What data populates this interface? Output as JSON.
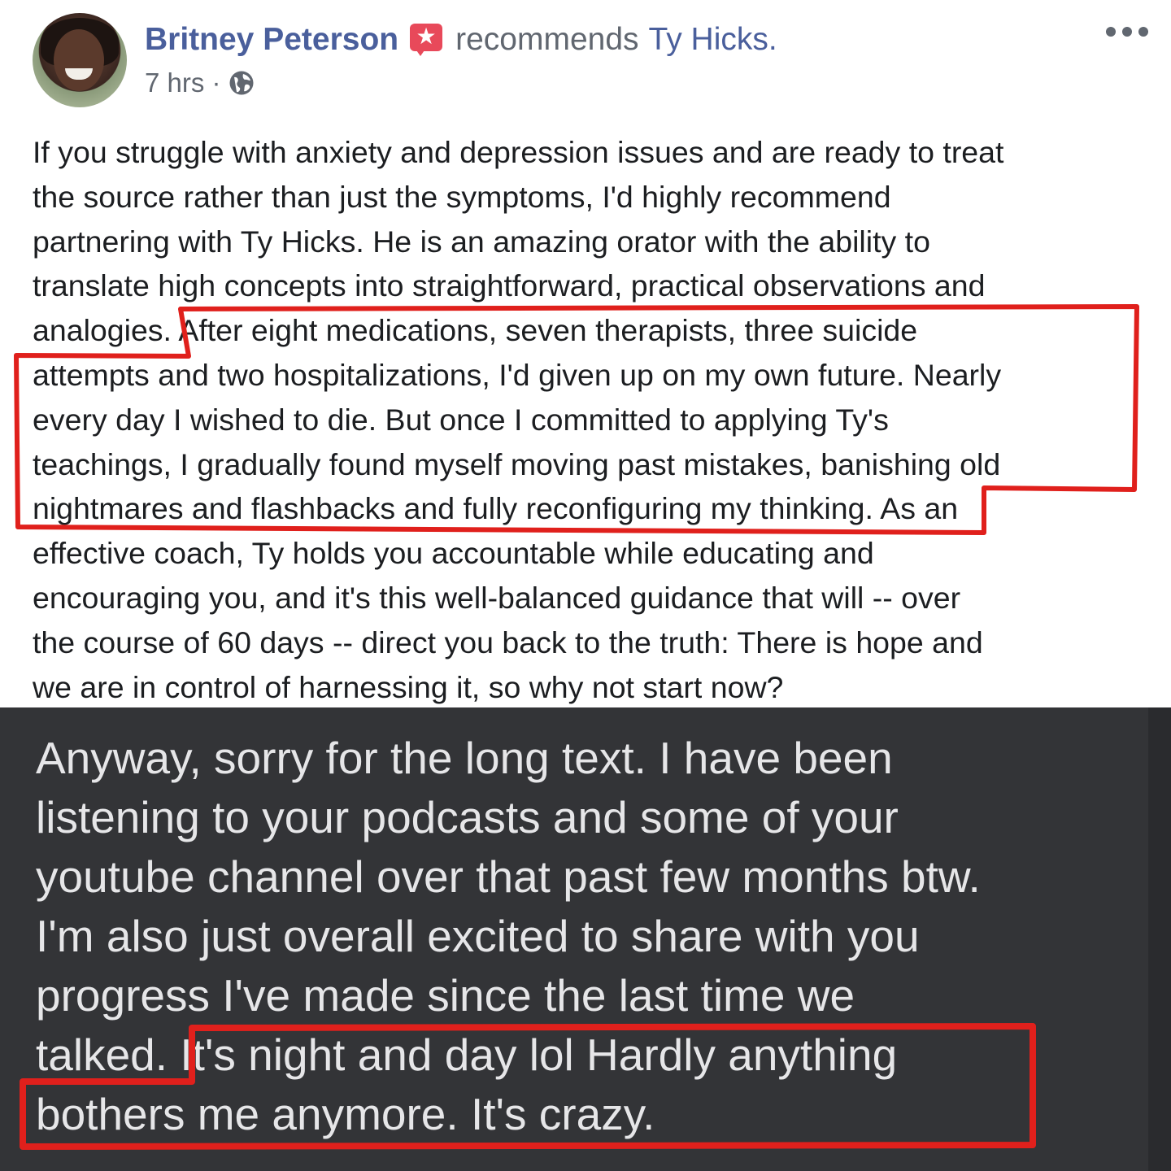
{
  "post": {
    "author": "Britney Peterson",
    "badge_icon": "recommendation-star-icon",
    "verb": "recommends",
    "target": "Ty Hicks.",
    "time": "7 hrs ·",
    "privacy_icon": "globe-icon",
    "more_icon": "ellipsis-icon",
    "body_lines": [
      "If you struggle with anxiety and depression issues and are ready to treat",
      "the source rather than just the symptoms, I'd highly recommend",
      "partnering with Ty Hicks. He is an amazing orator with the ability to",
      "translate high concepts into straightforward, practical observations and",
      "analogies. After eight medications, seven therapists, three suicide",
      "attempts and two hospitalizations, I'd given up on my own future. Nearly",
      "every day I wished to die. But once I committed to applying Ty's",
      "teachings, I gradually found myself moving past mistakes, banishing old",
      "nightmares and flashbacks and fully reconfiguring my thinking. As an",
      "effective coach, Ty holds you accountable while educating and",
      "encouraging you, and it's this well-balanced guidance that will -- over",
      "the course of 60 days -- direct you back to the truth: There is hope and",
      "we are in control of harnessing it, so why not start now?"
    ]
  },
  "message": {
    "lines": [
      "Anyway, sorry for the long text. I have been",
      "listening to your podcasts and some of your",
      "youtube channel over that past few months btw.",
      "I'm also just overall excited to share with you",
      "progress I've made since the last time we",
      "talked. It's night and day lol Hardly anything",
      "bothers me anymore. It's crazy."
    ]
  },
  "colors": {
    "link_blue": "#4a5f9c",
    "meta_gray": "#616770",
    "body_text": "#1c1e21",
    "message_bg": "#333437",
    "message_text": "#e6e6e8",
    "annotation_red": "#e0201c"
  }
}
